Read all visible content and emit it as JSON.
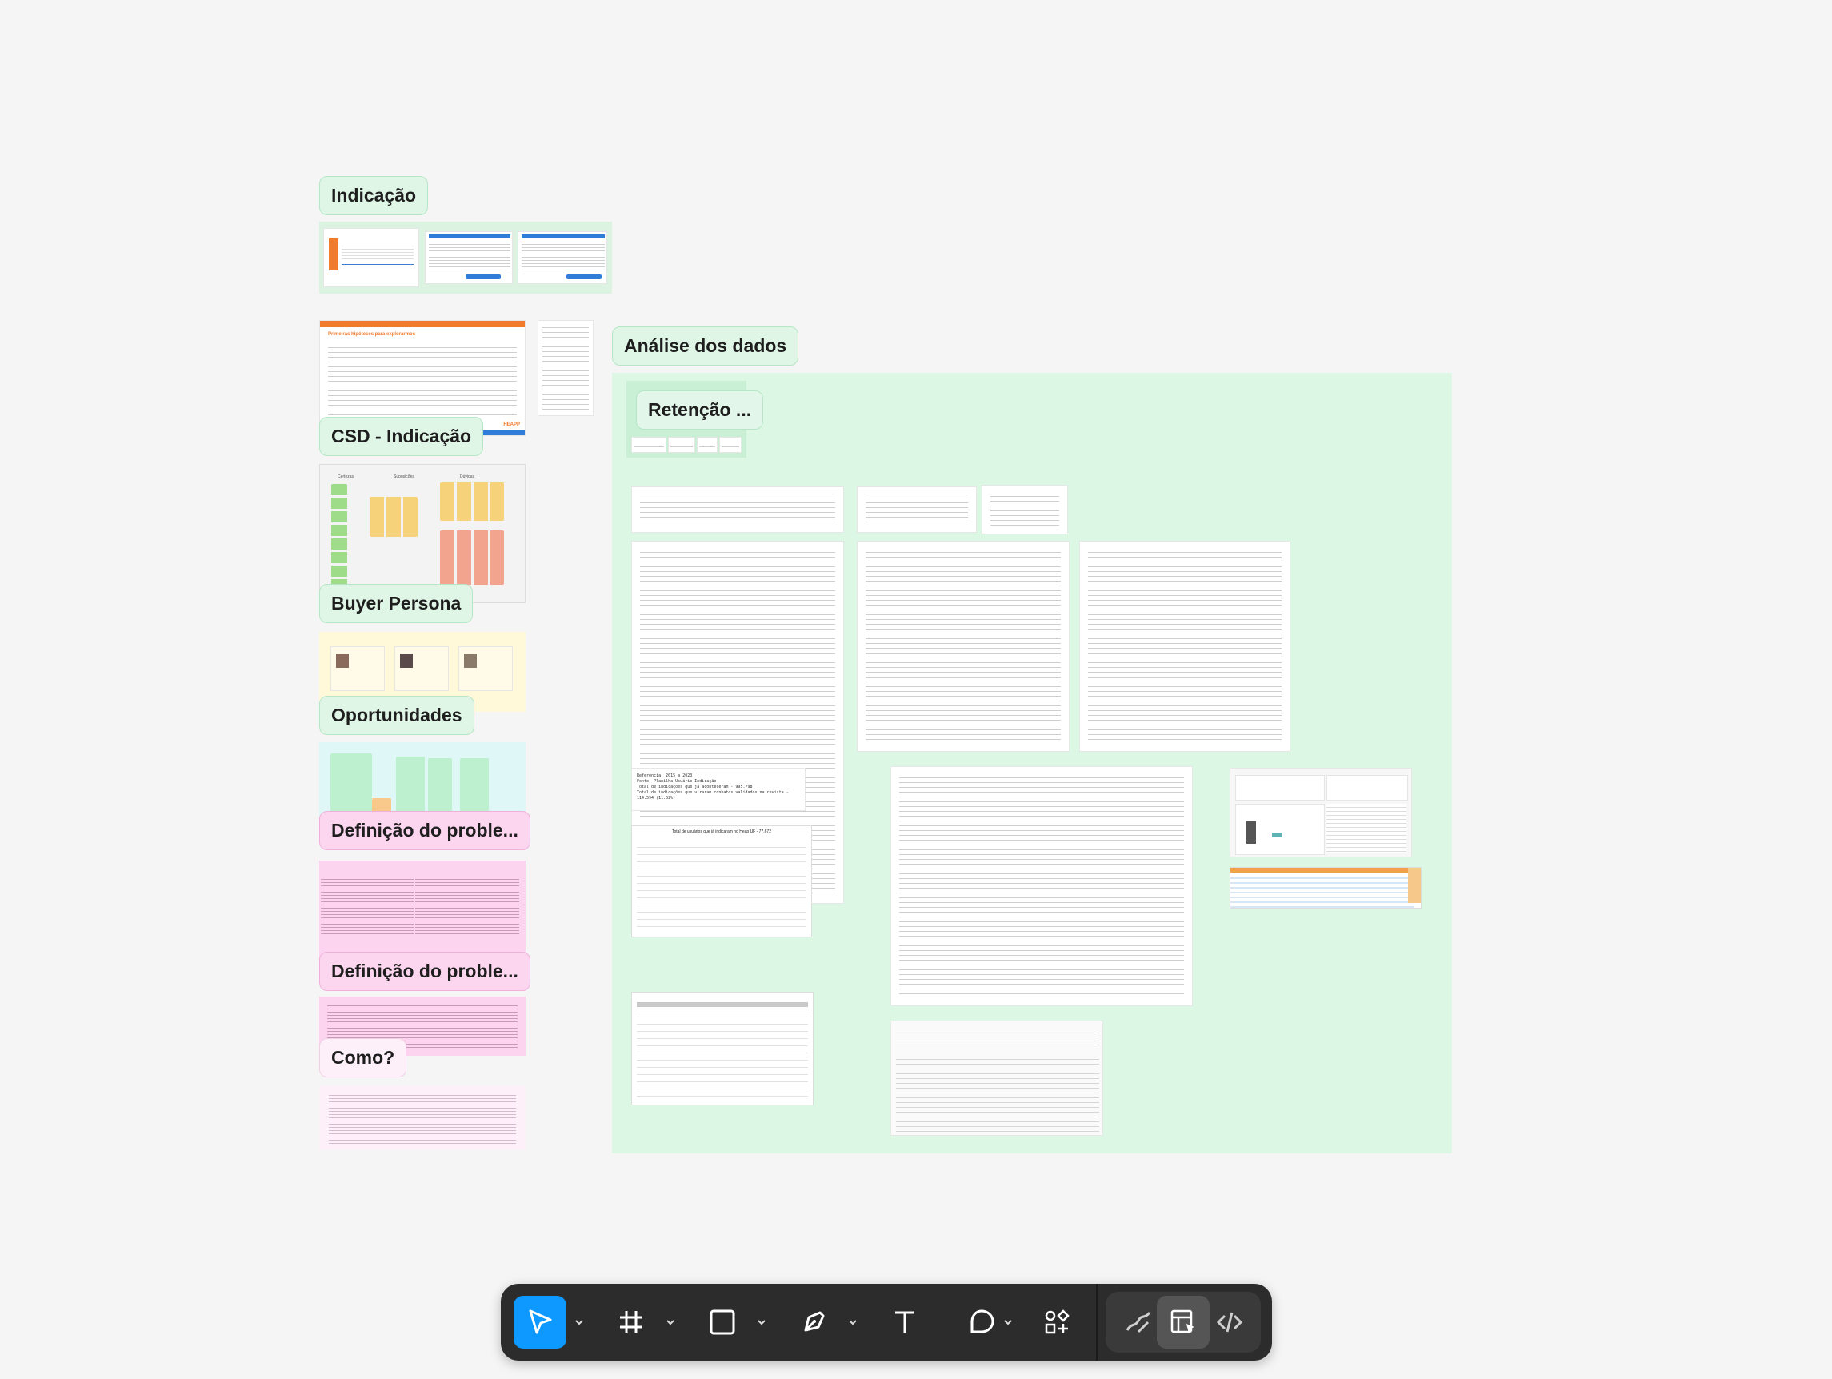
{
  "canvas": {
    "background": "#f5f5f5",
    "section_labels": {
      "indicacao": "Indicação",
      "analise": "Análise dos dados",
      "retencao": "Retenção ...",
      "csd": "CSD - Indicação",
      "buyer_persona": "Buyer Persona",
      "oportunidades": "Oportunidades",
      "definicao_1": "Definição do proble...",
      "definicao_2": "Definição do proble...",
      "como": "Como?"
    },
    "csd_doc_title": "Primeiras hipóteses para explorarmos",
    "brand_mark": "HEAPP",
    "buyer_persona_columns": [
      "Certezas",
      "Suposições",
      "Dúvidas"
    ],
    "analysis_snippets": {
      "totals_title": "Total de usuários que já indicaram no Heap UF - 77.672",
      "table_headers": [
        "Faixa",
        "Quantidade",
        "Faixa",
        "Quantidade"
      ],
      "table_rows": [
        [
          "1 a 5",
          "69.603",
          "1.001 a 1.500",
          "15"
        ],
        [
          "6 a 10",
          "4.729",
          "1.501 a 2.000",
          "15"
        ],
        [
          "11 a 20",
          "1.769",
          "2.001 a 3.000",
          "10"
        ],
        [
          "21 a 30",
          "532",
          "3.001 a 4.000",
          "5"
        ],
        [
          "31 a 40",
          "295",
          "4.001 a 6.000",
          "8"
        ],
        [
          "51 a 80",
          "186",
          "8.001 a 14.000",
          "3"
        ],
        [
          "81 a 100",
          "70",
          "",
          ""
        ],
        [
          "101 a 150",
          "115",
          "",
          ""
        ],
        [
          "151 a 200",
          "46",
          "",
          ""
        ],
        [
          "201 a 300",
          "48",
          "",
          ""
        ],
        [
          "301 a 400",
          "23",
          "",
          ""
        ],
        [
          "401 a 500",
          "22",
          "",
          ""
        ],
        [
          "501 a 600",
          "19",
          "",
          ""
        ],
        [
          "601 a 700",
          "17",
          "",
          ""
        ],
        [
          "701 a 1.000",
          "18",
          "",
          ""
        ]
      ],
      "reference_lines": [
        "Referência: 2015 a 2023",
        "Fonte: Planilha Usuário Indicação",
        "Total de indicações que já aconteceram - 995.798",
        "Total de indicações que viraram conbatos validados na revista - 114.594 (11.52%)"
      ],
      "meta_table_headers": [
        "Faixa de Meta",
        "Meta Mensal de Aquisição (Cadastros Válidos)",
        "Convites Necessários por Mês (25.92% CR)",
        "Total de Convites Projetados em 12 Meses"
      ],
      "meta_table_rows": [
        [
          "Meta 1 (BASELINE/Mínimo)",
          "3.347",
          "12.876",
          "167.712"
        ],
        [
          "Meta 2 (Crescimento Baixo)",
          "3.752",
          "11.800",
          "165.196"
        ],
        [
          "Meta 3 (Crescimento Moderado)",
          "5.227",
          "17.881",
          "224.681"
        ],
        [
          "Meta 4 (Crescimento Alto)",
          "5.902",
          "19.603",
          "236.224"
        ],
        [
          "Meta 5 (IDEAL/Alvo)",
          "6.305",
          "21.911",
          "262.720"
        ]
      ]
    }
  },
  "toolbar": {
    "tools": [
      {
        "name": "move-tool",
        "icon": "cursor-arrow-icon",
        "active": true
      },
      {
        "name": "frame-tool",
        "icon": "hash-frame-icon"
      },
      {
        "name": "rectangle-tool",
        "icon": "rectangle-icon"
      },
      {
        "name": "pen-tool",
        "icon": "pen-nib-icon"
      },
      {
        "name": "text-tool",
        "icon": "text-t-icon"
      },
      {
        "name": "comment-tool",
        "icon": "speech-bubble-icon"
      },
      {
        "name": "actions-tool",
        "icon": "shapes-plus-icon"
      }
    ],
    "right_tools": [
      {
        "name": "draw-mode",
        "icon": "draw-pencil-icon"
      },
      {
        "name": "design-mode",
        "icon": "design-layout-icon",
        "active": true
      },
      {
        "name": "dev-mode",
        "icon": "code-brackets-icon"
      }
    ],
    "accent_color": "#0d99ff"
  }
}
